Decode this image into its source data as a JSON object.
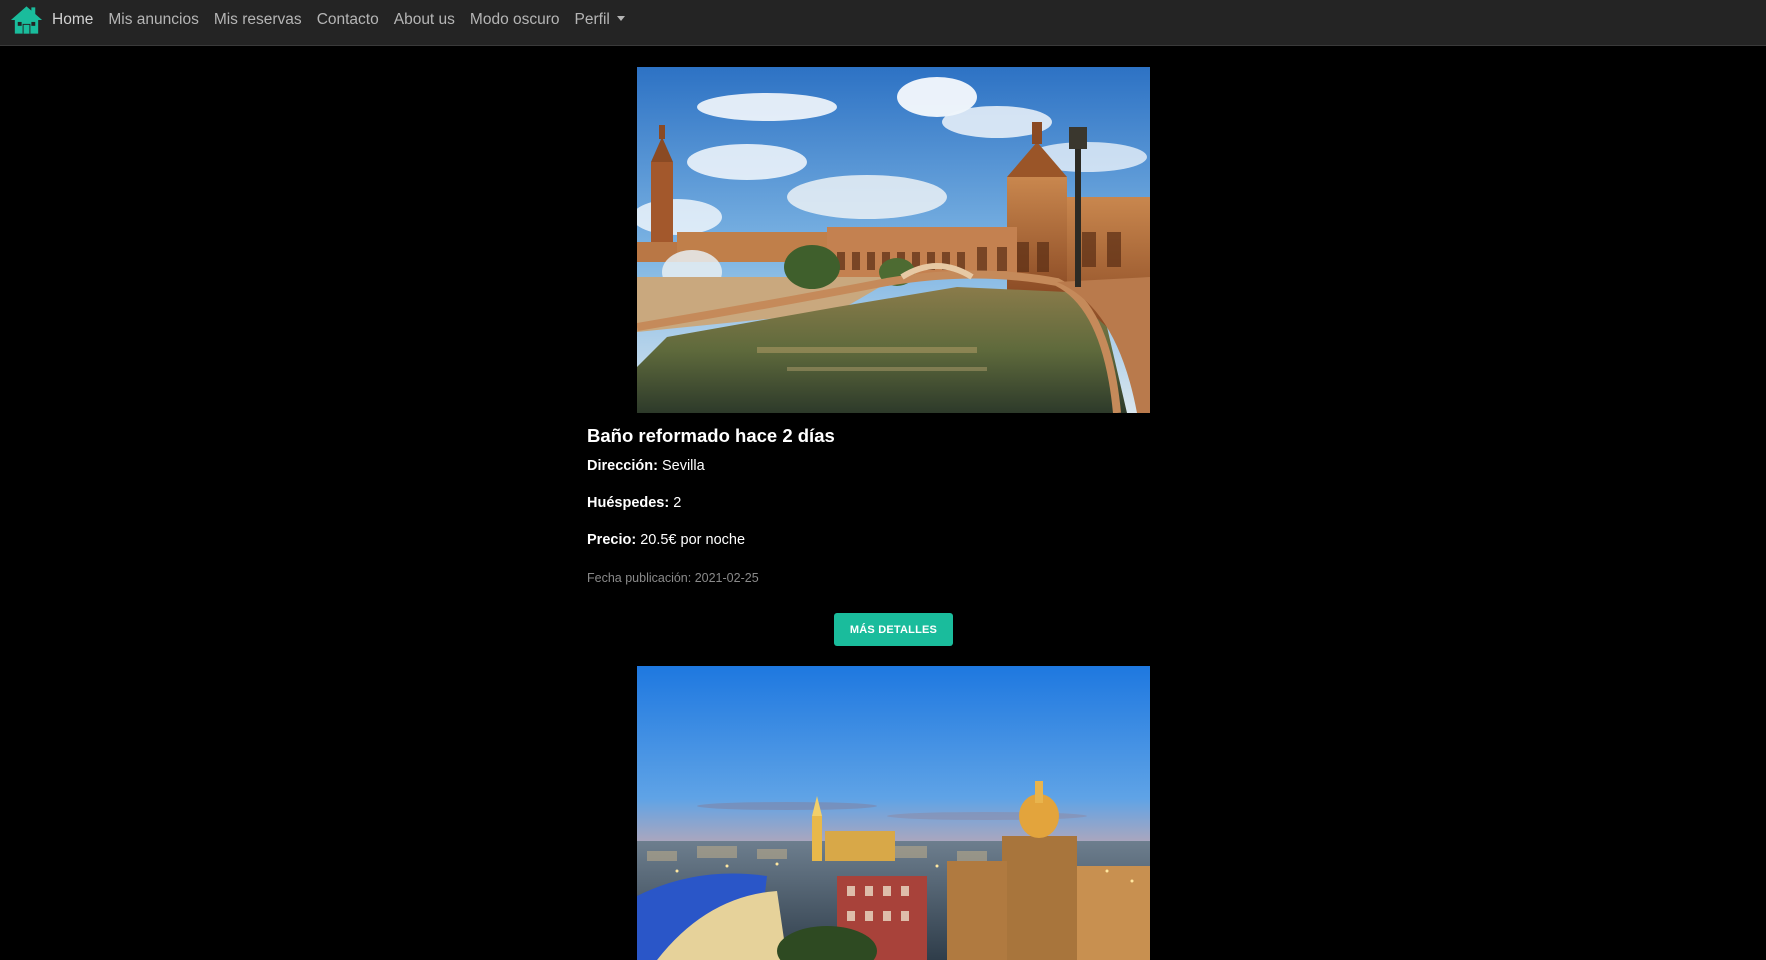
{
  "navbar": {
    "logo_icon": "home-icon",
    "accent_color": "#1abc9c",
    "links": [
      {
        "label": "Home"
      },
      {
        "label": "Mis anuncios"
      },
      {
        "label": "Mis reservas"
      },
      {
        "label": "Contacto"
      },
      {
        "label": "About us"
      },
      {
        "label": "Modo oscuro"
      },
      {
        "label": "Perfil",
        "dropdown": true
      }
    ]
  },
  "listings": [
    {
      "image": "Plaza de España, Sevilla",
      "title": "Baño reformado hace 2 días",
      "direccion_label": "Dirección:",
      "direccion_value": "Sevilla",
      "huespedes_label": "Huéspedes:",
      "huespedes_value": "2",
      "precio_label": "Precio:",
      "precio_value": "20.5€ por noche",
      "fecha_publicacion": "Fecha publicación: 2021-02-25",
      "button_label": "MÁS DETALLES"
    },
    {
      "image": "Seville skyline at dusk"
    }
  ]
}
